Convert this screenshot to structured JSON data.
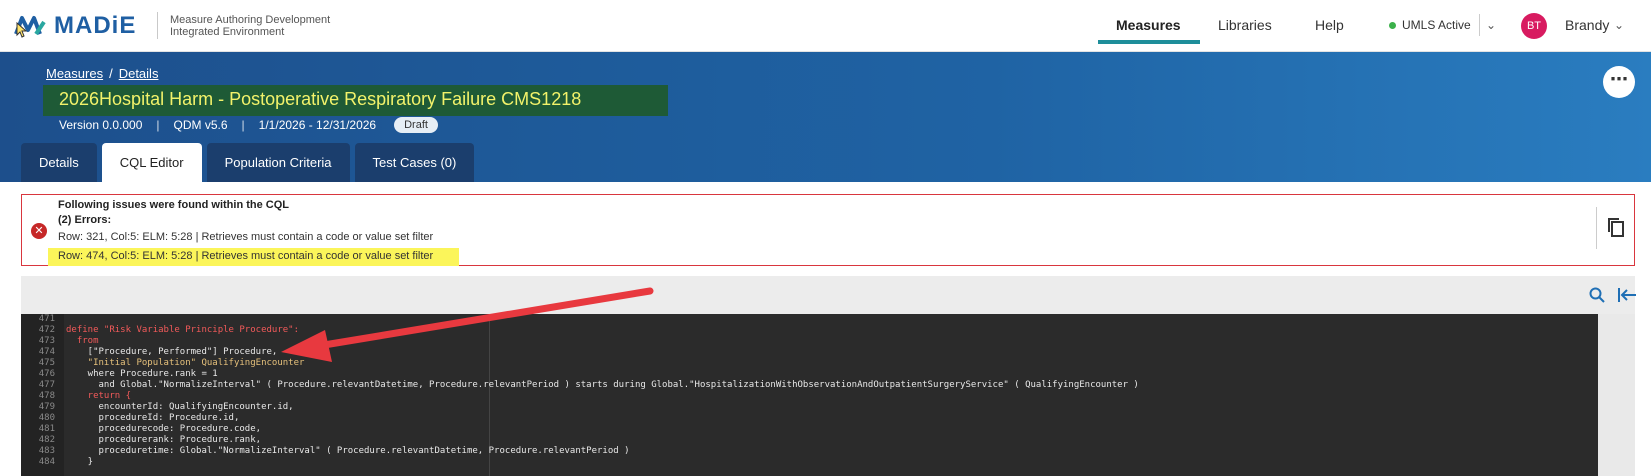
{
  "app": {
    "logo_text": "MADiE",
    "subtitle_line1": "Measure Authoring Development",
    "subtitle_line2": "Integrated Environment"
  },
  "nav": {
    "measures": "Measures",
    "libraries": "Libraries",
    "help": "Help",
    "umls_status": "UMLS Active",
    "avatar_initials": "BT",
    "username": "Brandy",
    "accent_color": "#1e8e9a"
  },
  "breadcrumb": {
    "measures": "Measures",
    "separator": "/",
    "details": "Details"
  },
  "measure": {
    "title": "2026Hospital Harm - Postoperative Respiratory Failure CMS1218",
    "version": "Version 0.0.000",
    "model": "QDM v5.6",
    "period": "1/1/2026 - 12/31/2026",
    "status": "Draft"
  },
  "tabs": [
    {
      "label": "Details",
      "active": false
    },
    {
      "label": "CQL Editor",
      "active": true
    },
    {
      "label": "Population Criteria",
      "active": false
    },
    {
      "label": "Test Cases (0)",
      "active": false
    }
  ],
  "errors": {
    "heading": "Following issues were found within the CQL",
    "count_label": "(2) Errors:",
    "items": [
      "Row: 321, Col:5: ELM: 5:28 | Retrieves must contain a code or value set filter",
      "Row: 474, Col:5: ELM: 5:28 | Retrieves must contain a code or value set filter"
    ]
  },
  "editor": {
    "line_numbers": [
      "471",
      "472",
      "473",
      "474",
      "475",
      "476",
      "477",
      "478",
      "479",
      "480",
      "481",
      "482",
      "483",
      "484"
    ],
    "lines": [
      "",
      "define \"Risk Variable Principle Procedure\":",
      "  from",
      "    [\"Procedure, Performed\"] Procedure,",
      "    \"Initial Population\" QualifyingEncounter",
      "    where Procedure.rank = 1",
      "      and Global.\"NormalizeInterval\" ( Procedure.relevantDatetime, Procedure.relevantPeriod ) starts during Global.\"HospitalizationWithObservationAndOutpatientSurgeryService\" ( QualifyingEncounter )",
      "    return {",
      "      encounterId: QualifyingEncounter.id,",
      "      procedureId: Procedure.id,",
      "      procedurecode: Procedure.code,",
      "      procedurerank: Procedure.rank,",
      "      proceduretime: Global.\"NormalizeInterval\" ( Procedure.relevantDatetime, Procedure.relevantPeriod )",
      "    }"
    ]
  },
  "icons": {
    "error": "error-circle-icon",
    "copy": "copy-icon",
    "search": "search-icon",
    "collapse": "collapse-left-icon",
    "more": "more-options-icon"
  }
}
